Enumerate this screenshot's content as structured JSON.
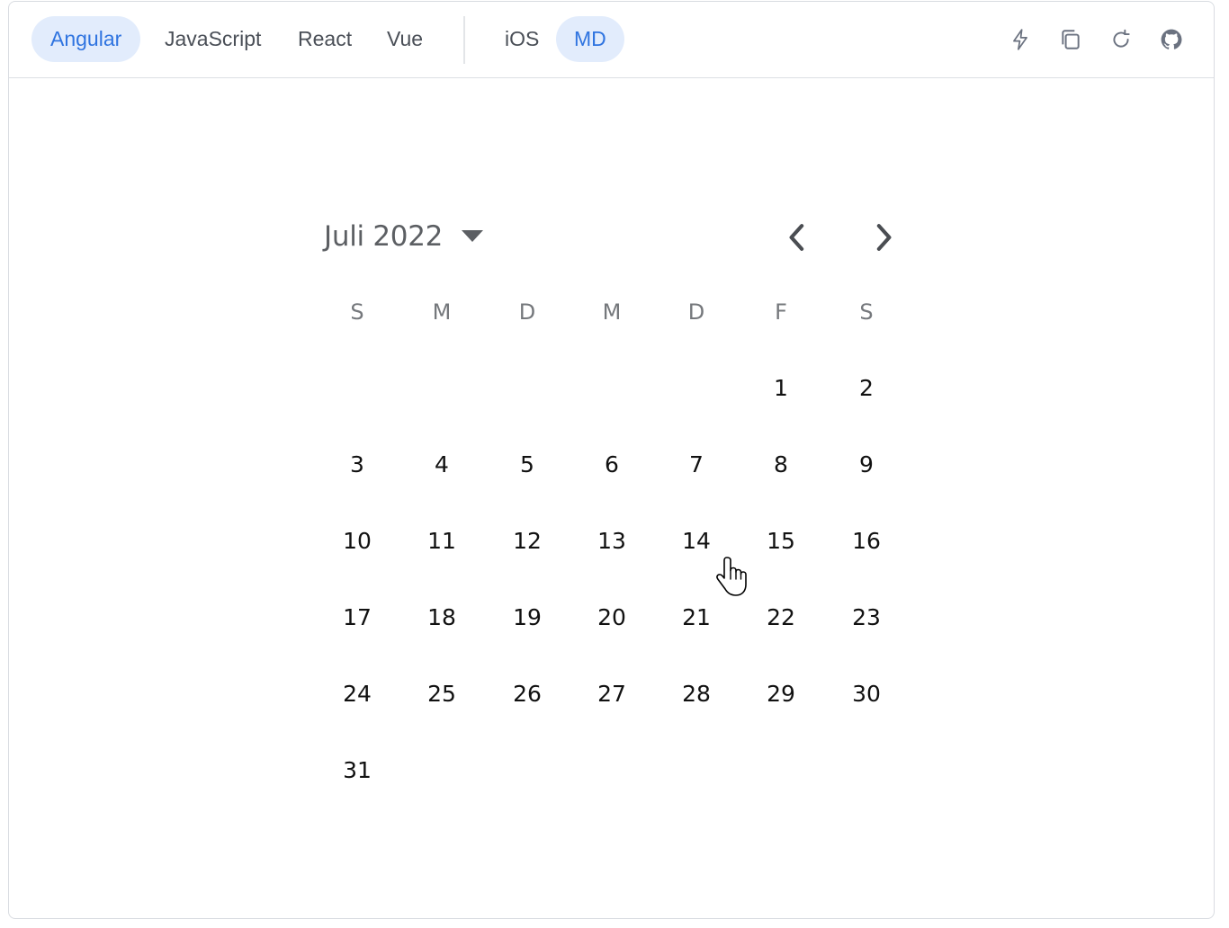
{
  "toolbar": {
    "framework_tabs": [
      "Angular",
      "JavaScript",
      "React",
      "Vue"
    ],
    "mode_tabs": [
      "iOS",
      "MD"
    ],
    "active_framework": "Angular",
    "active_mode": "MD",
    "tools": [
      "lightning-icon",
      "copy-icon",
      "refresh-icon",
      "github-icon"
    ],
    "accent_color": "#2f74e0",
    "active_bg": "#e2ecfc"
  },
  "calendar": {
    "month_label": "Juli 2022",
    "weekdays": [
      "S",
      "M",
      "D",
      "M",
      "D",
      "F",
      "S"
    ],
    "days": [
      [
        "",
        "",
        "",
        "",
        "",
        "1",
        "2"
      ],
      [
        "3",
        "4",
        "5",
        "6",
        "7",
        "8",
        "9"
      ],
      [
        "10",
        "11",
        "12",
        "13",
        "14",
        "15",
        "16"
      ],
      [
        "17",
        "18",
        "19",
        "20",
        "21",
        "22",
        "23"
      ],
      [
        "24",
        "25",
        "26",
        "27",
        "28",
        "29",
        "30"
      ],
      [
        "31",
        "",
        "",
        "",
        "",
        "",
        ""
      ]
    ],
    "prev_icon": "chevron-left-icon",
    "next_icon": "chevron-right-icon"
  }
}
